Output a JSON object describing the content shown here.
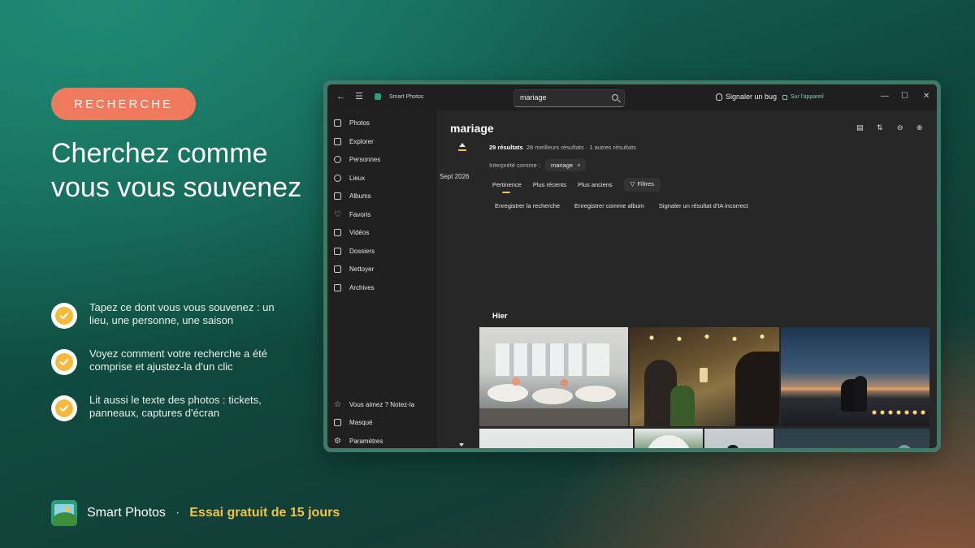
{
  "promo": {
    "badge": "RECHERCHE",
    "headline": "Cherchez comme vous vous souvenez",
    "features": [
      "Tapez ce dont vous vous souvenez : un lieu, une personne, une saison",
      "Voyez comment votre recherche a été comprise et ajustez-la d'un clic",
      "Lit aussi le texte des photos : tickets, panneaux, captures d'écran"
    ],
    "footer_app": "Smart Photos",
    "footer_separator": "·",
    "footer_trial": "Essai gratuit de 15 jours"
  },
  "window": {
    "app_title": "Smart Photos",
    "search_value": "mariage",
    "report_bug": "Signaler un bug",
    "on_device": "Sur l'appareil",
    "controls": [
      "—",
      "☐",
      "✕"
    ]
  },
  "sidebar": {
    "items": [
      {
        "label": "Photos",
        "icon": "photos-icon"
      },
      {
        "label": "Explorer",
        "icon": "explore-icon"
      },
      {
        "label": "Personnes",
        "icon": "people-icon"
      },
      {
        "label": "Lieux",
        "icon": "places-icon"
      },
      {
        "label": "Albums",
        "icon": "albums-icon"
      },
      {
        "label": "Favoris",
        "icon": "heart-icon"
      },
      {
        "label": "Vidéos",
        "icon": "video-icon"
      },
      {
        "label": "Dossiers",
        "icon": "folder-icon"
      },
      {
        "label": "Nettoyer",
        "icon": "trash-icon"
      },
      {
        "label": "Archives",
        "icon": "archive-icon"
      }
    ],
    "bottom_items": [
      {
        "label": "Vous aimez ? Notez-la",
        "icon": "star-icon"
      },
      {
        "label": "Masqué",
        "icon": "lock-icon"
      },
      {
        "label": "Paramètres",
        "icon": "gear-icon"
      }
    ]
  },
  "main": {
    "title": "mariage",
    "timeline_date": "Sept 2026",
    "results_count": "29 résultats",
    "results_detail": "28 meilleurs résultats · 1 autres résultats",
    "interpreted_label": "Interprété comme :",
    "interpreted_chip": "mariage",
    "chip_remove": "×",
    "sort_tabs": [
      "Pertinence",
      "Plus récents",
      "Plus anciens"
    ],
    "filters_label": "Filtres",
    "actions": [
      "Enregistrer la recherche",
      "Enregistrer comme album",
      "Signaler un résultat d'IA incorrect"
    ],
    "section_title": "Hier"
  }
}
